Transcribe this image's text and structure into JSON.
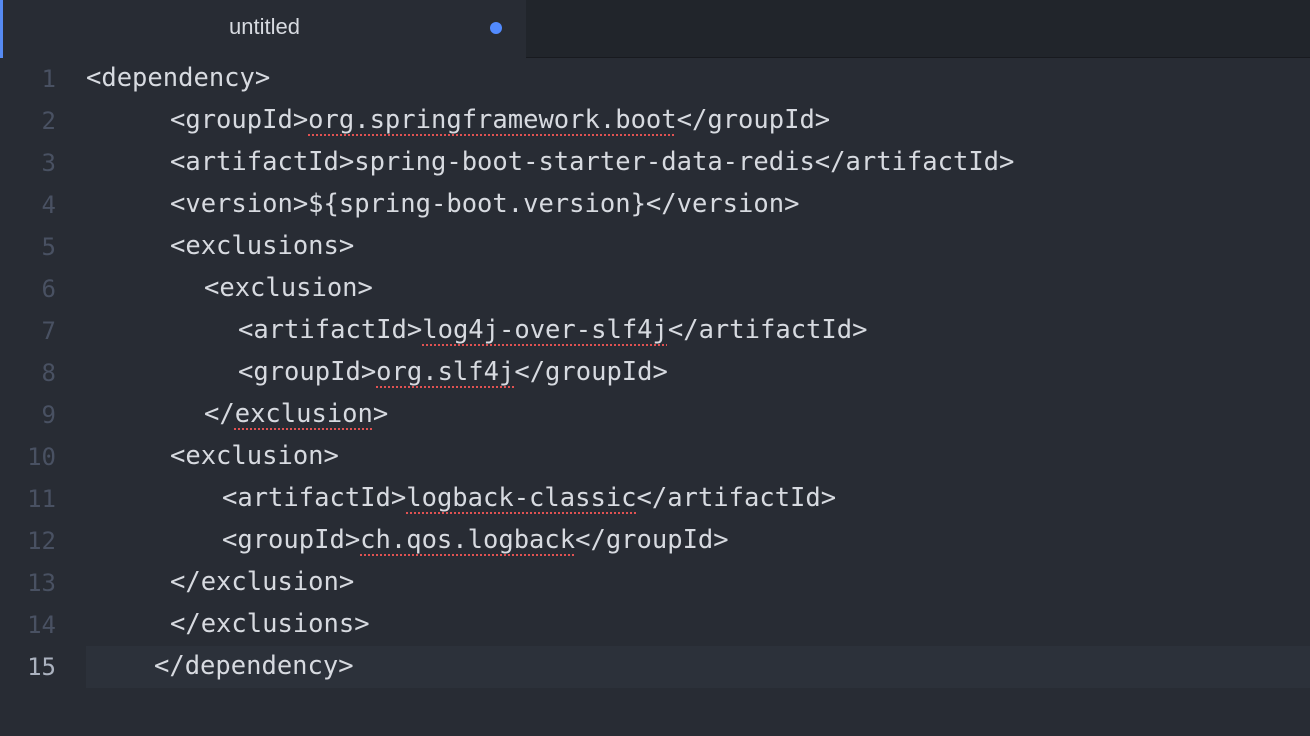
{
  "tab": {
    "title": "untitled",
    "modified_indicator": "unsaved-dot-icon"
  },
  "colors": {
    "background": "#282c34",
    "tabbar": "#21252b",
    "active_line": "#2c313a",
    "gutter_text": "#495162",
    "code_text": "#d7dae0",
    "modified_dot": "#528bff",
    "spell_underline": "#e05252"
  },
  "editor": {
    "active_line": 15,
    "lines": [
      {
        "number": "1",
        "before": "<dependency>",
        "word": "",
        "after": ""
      },
      {
        "number": "2",
        "before": "<groupId>",
        "word": "org.springframework.boot",
        "after": "</groupId>"
      },
      {
        "number": "3",
        "before": "<artifactId>spring-boot-starter-data-redis</artifactId>",
        "word": "",
        "after": ""
      },
      {
        "number": "4",
        "before": "<version>${spring-boot.version}</version>",
        "word": "",
        "after": ""
      },
      {
        "number": "5",
        "before": "<exclusions>",
        "word": "",
        "after": ""
      },
      {
        "number": "6",
        "before": "<exclusion>",
        "word": "",
        "after": ""
      },
      {
        "number": "7",
        "before": "<artifactId>",
        "word": "log4j-over-slf4j",
        "after": "</artifactId>"
      },
      {
        "number": "8",
        "before": "<groupId>",
        "word": "org.slf4j",
        "after": "</groupId>"
      },
      {
        "number": "9",
        "before": "</",
        "word": "exclusion",
        "after": ">"
      },
      {
        "number": "10",
        "before": "<exclusion>",
        "word": "",
        "after": ""
      },
      {
        "number": "11",
        "before": "<artifactId>",
        "word": "logback-classic",
        "after": "</artifactId>"
      },
      {
        "number": "12",
        "before": "<groupId>",
        "word": "ch.qos.logback",
        "after": "</groupId>"
      },
      {
        "number": "13",
        "before": "</exclusion>",
        "word": "",
        "after": ""
      },
      {
        "number": "14",
        "before": "</exclusions>",
        "word": "",
        "after": ""
      },
      {
        "number": "15",
        "before": "</dependency>",
        "word": "",
        "after": ""
      }
    ]
  }
}
